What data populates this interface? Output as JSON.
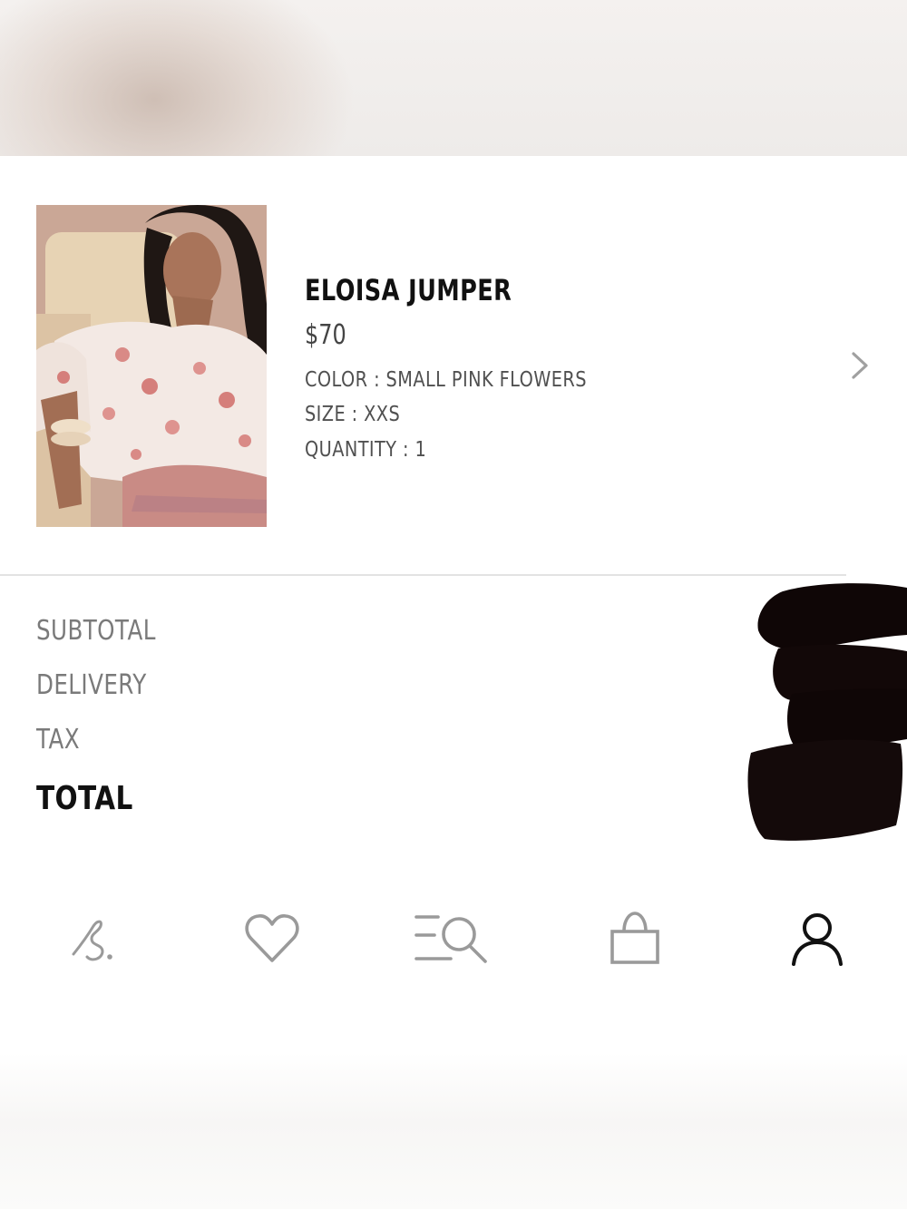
{
  "product": {
    "name": "ELOISA JUMPER",
    "price": "$70",
    "color": "COLOR : SMALL PINK FLOWERS",
    "size": "SIZE : XXS",
    "quantity": "QUANTITY : 1",
    "image_alt": "Model wearing cream jumper with small pink flowers"
  },
  "summary": {
    "subtotal_label": "SUBTOTAL",
    "delivery_label": "DELIVERY",
    "tax_label": "TAX",
    "total_label": "TOTAL"
  },
  "nav": {
    "items": [
      {
        "icon": "home-logo-icon",
        "state": "inactive"
      },
      {
        "icon": "heart-icon",
        "state": "inactive"
      },
      {
        "icon": "search-menu-icon",
        "state": "inactive"
      },
      {
        "icon": "shopping-bag-icon",
        "state": "inactive"
      },
      {
        "icon": "account-icon",
        "state": "active"
      }
    ]
  },
  "colors": {
    "text_primary": "#111111",
    "text_secondary": "#505050",
    "text_muted": "#7a7a7a",
    "icon_inactive": "#9a9a9a",
    "icon_active": "#111111",
    "divider": "#e3e3e3"
  }
}
